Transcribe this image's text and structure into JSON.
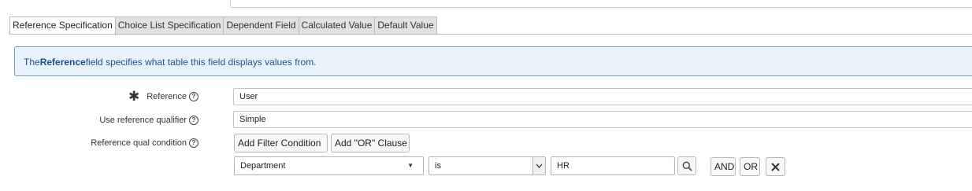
{
  "tabs": [
    {
      "label": "Reference Specification",
      "active": true
    },
    {
      "label": "Choice List Specification",
      "active": false
    },
    {
      "label": "Dependent Field",
      "active": false
    },
    {
      "label": "Calculated Value",
      "active": false
    },
    {
      "label": "Default Value",
      "active": false
    }
  ],
  "info": {
    "prefix": "The",
    "bold": "Reference",
    "suffix": "field specifies what table this field displays values from."
  },
  "form": {
    "reference": {
      "label": "Reference",
      "value": "User",
      "mandatory_mark": "✱",
      "help": "?"
    },
    "qualifier": {
      "label": "Use reference qualifier",
      "value": "Simple",
      "help": "?"
    },
    "condition": {
      "label": "Reference qual condition",
      "help": "?"
    }
  },
  "filter": {
    "add_condition_label": "Add Filter Condition",
    "add_or_label": "Add \"OR\" Clause",
    "field_value": "Department",
    "operator_value": "is",
    "value": "HR",
    "and_label": "AND",
    "or_label": "OR",
    "icons": {
      "search": "search-icon",
      "remove": "close-icon",
      "dropdown": "chevron-down-icon"
    }
  },
  "colors": {
    "info_bg": "#e8f2fb",
    "info_border": "#6f9fc6",
    "info_text": "#1f4f8a"
  }
}
